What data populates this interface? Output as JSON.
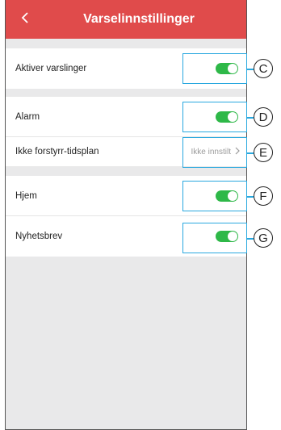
{
  "header": {
    "title": "Varselinnstillinger",
    "back_icon": "chevron-left-icon",
    "background_color": "#e04b4b"
  },
  "section1": {
    "rows": [
      {
        "label": "Aktiver varslinger",
        "toggle_on": true,
        "marker": "C"
      }
    ]
  },
  "section2": {
    "rows": [
      {
        "label": "Alarm",
        "toggle_on": true,
        "marker": "D"
      },
      {
        "label": "Ikke forstyrr-tidsplan",
        "value": "Ikke innstilt",
        "value_icon": "chevron-right-icon",
        "marker": "E"
      }
    ]
  },
  "section3": {
    "rows": [
      {
        "label": "Hjem",
        "toggle_on": true,
        "marker": "F"
      },
      {
        "label": "Nyhetsbrev",
        "toggle_on": true,
        "marker": "G"
      }
    ]
  },
  "colors": {
    "toggle_on": "#2eb848",
    "callout": "#29a8df",
    "page_background": "#e9e9ea"
  }
}
